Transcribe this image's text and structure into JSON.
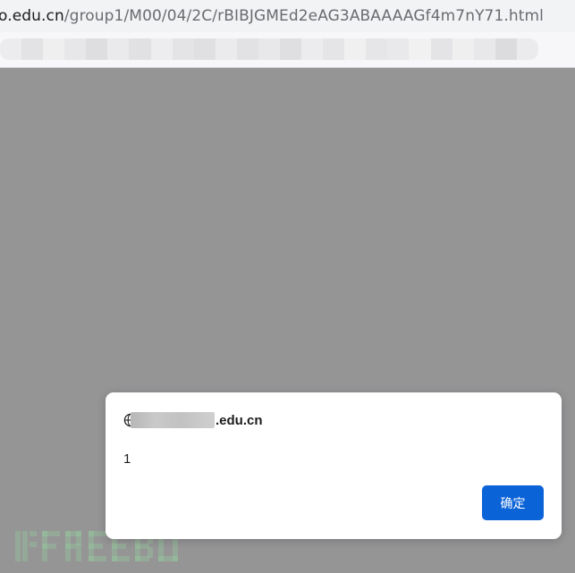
{
  "address_bar": {
    "url_host": "o.edu.cn",
    "url_path": "/group1/M00/04/2C/rBIBJGMEd2eAG3ABAAAAGf4m7nY71.html"
  },
  "dialog": {
    "origin_domain": ".edu.cn",
    "message": "1",
    "ok_label": "确定",
    "accent_color": "#0b63d8"
  },
  "watermark": {
    "icon": "freebuf-logo"
  },
  "colors": {
    "page_overlay": "#959596",
    "dialog_bg": "#ffffff"
  }
}
